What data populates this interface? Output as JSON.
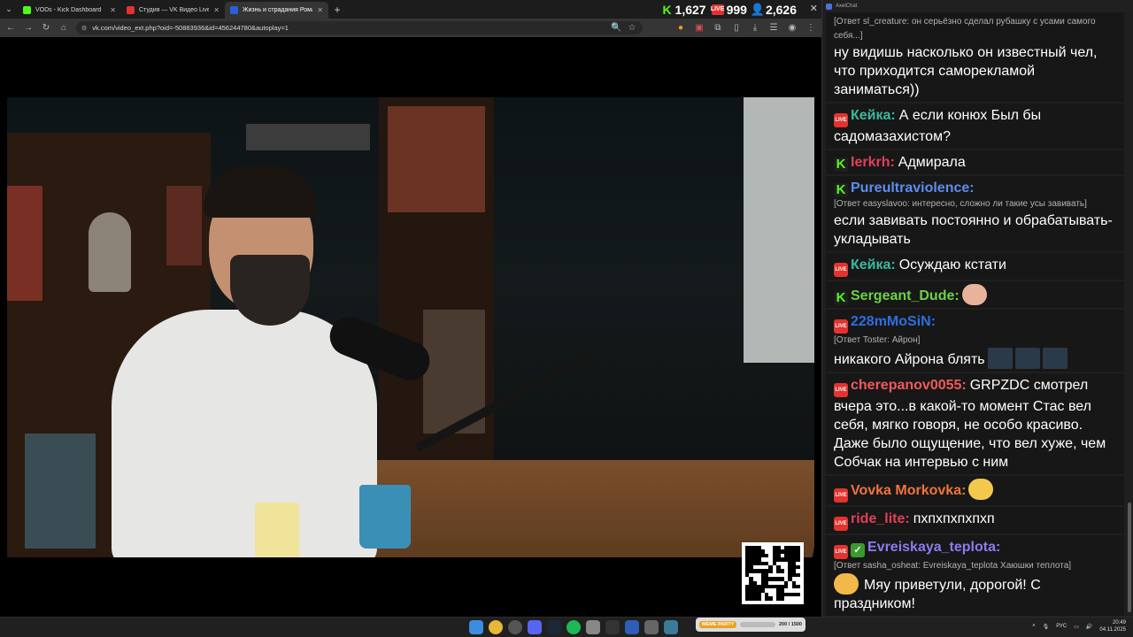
{
  "browser": {
    "tabs": [
      {
        "title": "VODs - Kick Dashboard",
        "favicon_color": "#53fc18"
      },
      {
        "title": "Студия — VK Видео Live",
        "favicon_color": "#e4322e"
      },
      {
        "title": "Жизнь и страдания Роман",
        "favicon_color": "#2a5fd6"
      }
    ],
    "url": "vk.com/video_ext.php?oid=-50883936&id=456244780&autoplay=1"
  },
  "stats": {
    "kick": "1,627",
    "vk": "999",
    "vk_badge": "LIVE",
    "viewers": "2,626"
  },
  "chat": {
    "window_title": "AxelChat",
    "messages": [
      {
        "badge": "",
        "user": "",
        "user_color": "",
        "reply": "[Ответ sl_creature: он серьёзно сделал рубашку с усами самого себя...]",
        "text": "ну видишь насколько он известный чел, что приходится саморекламой заниматься))",
        "emote": ""
      },
      {
        "badge": "vk",
        "user": "Кейка:",
        "user_color": "#3cb9a0",
        "reply": "",
        "text": "А если конюх Был бы садомазахистом?",
        "emote": ""
      },
      {
        "badge": "kick",
        "user": "Ierkrh:",
        "user_color": "#e0405a",
        "reply": "",
        "text": "Адмирала",
        "emote": ""
      },
      {
        "badge": "kick",
        "user": "Pureultraviolence:",
        "user_color": "#5f8cf0",
        "reply": "[Ответ easyslavoo: интересно, сложно ли такие усы завивать]",
        "text": "если завивать постоянно и обрабатывать-укладывать",
        "emote": ""
      },
      {
        "badge": "vk",
        "user": "Кейка:",
        "user_color": "#3cb9a0",
        "reply": "",
        "text": "Осуждаю кстати",
        "emote": ""
      },
      {
        "badge": "kick",
        "user": "Sergeant_Dude:",
        "user_color": "#6cd24a",
        "reply": "",
        "text": "",
        "emote": "bald-head-emote"
      },
      {
        "badge": "vk",
        "user": "228mMoSiN:",
        "user_color": "#2d6fe0",
        "reply": "[Ответ Toster: Айрон]",
        "text": "никакого Айрона блять",
        "emote": "dark-emote"
      },
      {
        "badge": "vk",
        "user": "cherepanov0055:",
        "user_color": "#f05a5a",
        "reply": "",
        "text": "GRPZDC смотрел вчера это...в какой-то момент Стас вел себя, мягко говоря, не особо красиво. Даже было ощущение, что вел хуже, чем Собчак на интервью с ним",
        "emote": ""
      },
      {
        "badge": "vk",
        "user": "Vovka Morkovka:",
        "user_color": "#f0743c",
        "reply": "",
        "text": "",
        "emote": "smile-emote"
      },
      {
        "badge": "vk",
        "user": "ride_lite:",
        "user_color": "#e0405a",
        "reply": "",
        "text": "пхпхпхпхпхп",
        "emote": ""
      },
      {
        "badge": "vk-check",
        "user": "Evreiskaya_teplota:",
        "user_color": "#8a7cf0",
        "reply": "[Ответ sasha_osheat: Evreiskaya_teplota Хаюшки теплота]",
        "text": "Мяу приветули, дорогой! С праздником!",
        "emote": "hug-emote"
      }
    ]
  },
  "taskbar": {
    "meme_label": "MEME PARTY",
    "meme_progress": "200 / 1500",
    "lang": "РУС",
    "time": "20:49",
    "date": "04.11.2025"
  }
}
